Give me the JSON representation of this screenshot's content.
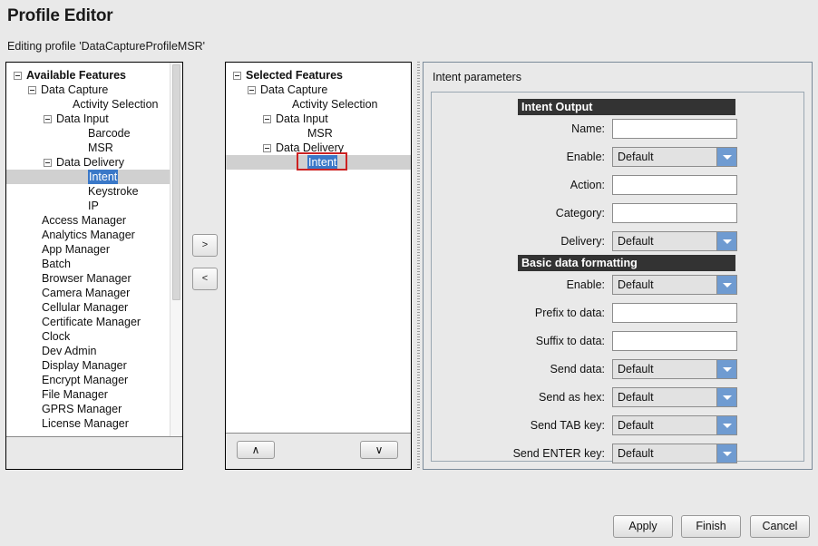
{
  "header": {
    "title": "Profile Editor",
    "subtitle": "Editing profile 'DataCaptureProfileMSR'"
  },
  "available_tree": {
    "items": [
      {
        "label": "Available Features",
        "indent": 0,
        "expander": true,
        "bold": true,
        "selected": false
      },
      {
        "label": "Data Capture",
        "indent": 1,
        "expander": true,
        "bold": false,
        "selected": false
      },
      {
        "label": "Activity Selection",
        "indent": 3,
        "expander": false,
        "bold": false,
        "selected": false
      },
      {
        "label": "Data Input",
        "indent": 2,
        "expander": true,
        "bold": false,
        "selected": false
      },
      {
        "label": "Barcode",
        "indent": 4,
        "expander": false,
        "bold": false,
        "selected": false
      },
      {
        "label": "MSR",
        "indent": 4,
        "expander": false,
        "bold": false,
        "selected": false
      },
      {
        "label": "Data Delivery",
        "indent": 2,
        "expander": true,
        "bold": false,
        "selected": false
      },
      {
        "label": "Intent",
        "indent": 4,
        "expander": false,
        "bold": false,
        "selected": true
      },
      {
        "label": "Keystroke",
        "indent": 4,
        "expander": false,
        "bold": false,
        "selected": false
      },
      {
        "label": "IP",
        "indent": 4,
        "expander": false,
        "bold": false,
        "selected": false
      },
      {
        "label": "Access Manager",
        "indent": 1,
        "expander": false,
        "bold": false,
        "selected": false
      },
      {
        "label": "Analytics Manager",
        "indent": 1,
        "expander": false,
        "bold": false,
        "selected": false
      },
      {
        "label": "App Manager",
        "indent": 1,
        "expander": false,
        "bold": false,
        "selected": false
      },
      {
        "label": "Batch",
        "indent": 1,
        "expander": false,
        "bold": false,
        "selected": false
      },
      {
        "label": "Browser Manager",
        "indent": 1,
        "expander": false,
        "bold": false,
        "selected": false
      },
      {
        "label": "Camera Manager",
        "indent": 1,
        "expander": false,
        "bold": false,
        "selected": false
      },
      {
        "label": "Cellular Manager",
        "indent": 1,
        "expander": false,
        "bold": false,
        "selected": false
      },
      {
        "label": "Certificate Manager",
        "indent": 1,
        "expander": false,
        "bold": false,
        "selected": false
      },
      {
        "label": "Clock",
        "indent": 1,
        "expander": false,
        "bold": false,
        "selected": false
      },
      {
        "label": "Dev Admin",
        "indent": 1,
        "expander": false,
        "bold": false,
        "selected": false
      },
      {
        "label": "Display Manager",
        "indent": 1,
        "expander": false,
        "bold": false,
        "selected": false
      },
      {
        "label": "Encrypt Manager",
        "indent": 1,
        "expander": false,
        "bold": false,
        "selected": false
      },
      {
        "label": "File Manager",
        "indent": 1,
        "expander": false,
        "bold": false,
        "selected": false
      },
      {
        "label": "GPRS Manager",
        "indent": 1,
        "expander": false,
        "bold": false,
        "selected": false
      },
      {
        "label": "License Manager",
        "indent": 1,
        "expander": false,
        "bold": false,
        "selected": false
      }
    ]
  },
  "selected_tree": {
    "items": [
      {
        "label": "Selected Features",
        "indent": 0,
        "expander": true,
        "bold": true,
        "selected": false
      },
      {
        "label": "Data Capture",
        "indent": 1,
        "expander": true,
        "bold": false,
        "selected": false
      },
      {
        "label": "Activity Selection",
        "indent": 3,
        "expander": false,
        "bold": false,
        "selected": false
      },
      {
        "label": "Data Input",
        "indent": 2,
        "expander": true,
        "bold": false,
        "selected": false
      },
      {
        "label": "MSR",
        "indent": 4,
        "expander": false,
        "bold": false,
        "selected": false
      },
      {
        "label": "Data Delivery",
        "indent": 2,
        "expander": true,
        "bold": false,
        "selected": false
      },
      {
        "label": "Intent",
        "indent": 4,
        "expander": false,
        "bold": false,
        "selected": true
      }
    ]
  },
  "transfer": {
    "add_label": ">",
    "remove_label": "<"
  },
  "reorder": {
    "up_label": "∧",
    "down_label": "∨"
  },
  "params": {
    "title": "Intent parameters",
    "sections": [
      {
        "header": "Intent Output",
        "fields": [
          {
            "label": "Name:",
            "type": "text",
            "value": ""
          },
          {
            "label": "Enable:",
            "type": "combo",
            "value": "Default"
          },
          {
            "label": "Action:",
            "type": "text",
            "value": ""
          },
          {
            "label": "Category:",
            "type": "text",
            "value": ""
          },
          {
            "label": "Delivery:",
            "type": "combo",
            "value": "Default"
          }
        ]
      },
      {
        "header": "Basic data formatting",
        "fields": [
          {
            "label": "Enable:",
            "type": "combo",
            "value": "Default"
          },
          {
            "label": "Prefix to data:",
            "type": "text",
            "value": ""
          },
          {
            "label": "Suffix to data:",
            "type": "text",
            "value": ""
          },
          {
            "label": "Send data:",
            "type": "combo",
            "value": "Default"
          },
          {
            "label": "Send as hex:",
            "type": "combo",
            "value": "Default"
          },
          {
            "label": "Send TAB key:",
            "type": "combo",
            "value": "Default"
          },
          {
            "label": "Send ENTER key:",
            "type": "combo",
            "value": "Default"
          }
        ]
      }
    ]
  },
  "footer_buttons": {
    "apply": "Apply",
    "finish": "Finish",
    "cancel": "Cancel"
  },
  "colors": {
    "selection_blue": "#3a78c8",
    "row_highlight": "#d0d0d0",
    "section_header_bg": "#333333",
    "combo_arrow_bg": "#6f9bd1",
    "annotation_red": "#cc2222",
    "window_bg": "#e9e9e9"
  }
}
